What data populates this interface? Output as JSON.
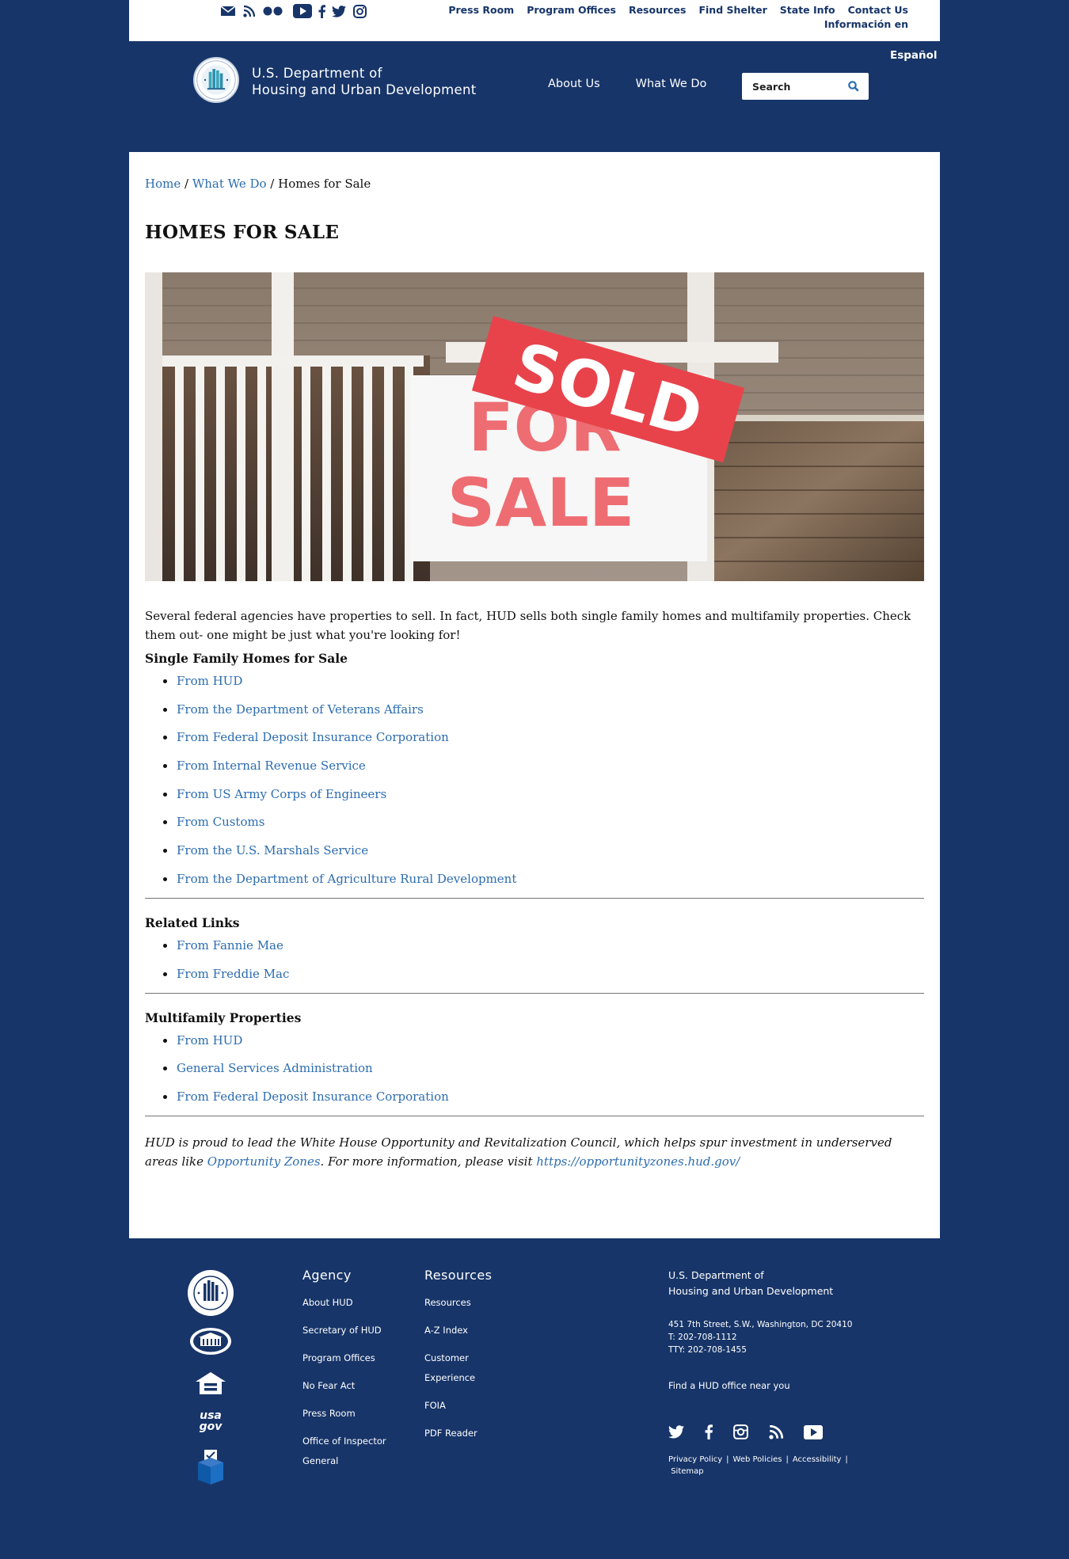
{
  "utility_nav": {
    "social_icons": [
      "mail-icon",
      "rss-icon",
      "flickr-icon",
      "youtube-icon",
      "facebook-icon",
      "twitter-icon",
      "instagram-icon"
    ],
    "links": [
      "Press Room",
      "Program Offices",
      "Resources",
      "Find Shelter",
      "State Info",
      "Contact Us",
      "Información en"
    ],
    "link_wrap": "Español"
  },
  "header": {
    "espanol": "Español",
    "dept_line1": "U.S. Department of",
    "dept_line2": "Housing and Urban Development",
    "nav": [
      "About Us",
      "What We Do"
    ],
    "search_placeholder": "Search"
  },
  "breadcrumb": {
    "home": "Home",
    "sep1": " / ",
    "parent": "What We Do",
    "sep2": " / ",
    "current": "Homes for Sale"
  },
  "page": {
    "title": "HOMES FOR SALE",
    "hero_sign_sold": "SOLD",
    "hero_sign_for": "FOR",
    "hero_sign_sale": "SALE",
    "intro": "Several federal agencies have properties to sell. In fact, HUD sells both single family homes and multifamily properties. Check them out- one might be just what you're looking for!",
    "single_family": {
      "heading": "Single Family Homes for Sale",
      "links": [
        "From HUD",
        "From the Department of Veterans Affairs",
        "From Federal Deposit Insurance Corporation",
        "From Internal Revenue Service",
        "From US Army Corps of Engineers",
        "From Customs",
        "From the U.S. Marshals Service",
        "From the Department of Agriculture Rural Development"
      ]
    },
    "related": {
      "heading": "Related Links",
      "links": [
        "From Fannie Mae",
        "From Freddie Mac"
      ]
    },
    "multifamily": {
      "heading": "Multifamily Properties",
      "links": [
        "From HUD",
        "General Services Administration",
        "From Federal Deposit Insurance Corporation"
      ]
    },
    "closing": {
      "text1": "HUD is proud to lead the White House Opportunity and Revitalization Council, which helps spur investment in underserved areas like ",
      "link1": "Opportunity Zones",
      "text2": ". For more information, please visit ",
      "link2": "https://opportunityzones.hud.gov/"
    }
  },
  "footer": {
    "logos": [
      "hud-seal-icon",
      "white-house-icon",
      "equal-housing-icon",
      "usagov-logo",
      "vote-icon"
    ],
    "usagov_text": "usa gov",
    "agency": {
      "heading": "Agency",
      "links": [
        "About HUD",
        "Secretary of HUD",
        "Program Offices",
        "No Fear Act",
        "Press Room",
        "Office of Inspector General"
      ]
    },
    "resources": {
      "heading": "Resources",
      "links": [
        "Resources",
        "A-Z Index",
        "Customer Experience",
        "FOIA",
        "PDF Reader"
      ]
    },
    "contact": {
      "dept_line1": "U.S. Department of",
      "dept_line2": "Housing and Urban Development",
      "address": "451 7th Street, S.W., Washington, DC 20410",
      "phone": "T: 202-708-1112",
      "tty": "TTY: 202-708-1455",
      "office_link": "Find a HUD office near you",
      "social_icons": [
        "twitter-icon",
        "facebook-icon",
        "instagram-icon",
        "rss-icon",
        "youtube-icon"
      ],
      "legal": [
        "Privacy Policy",
        "Web Policies",
        "Accessibility",
        "Sitemap"
      ],
      "legal_sep": "|"
    }
  },
  "colors": {
    "navy": "#173569",
    "link": "#2b6cb0",
    "sign_red": "#e8434b"
  }
}
